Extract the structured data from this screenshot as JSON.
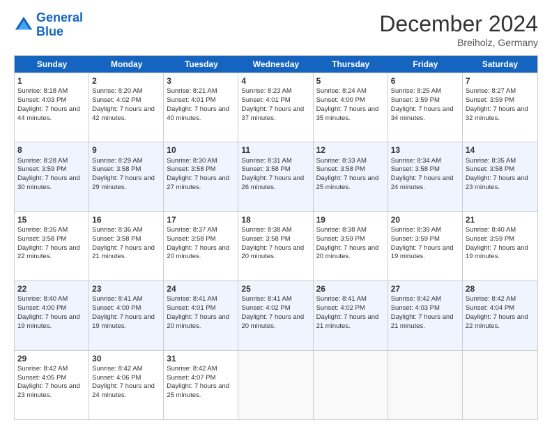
{
  "header": {
    "logo_line1": "General",
    "logo_line2": "Blue",
    "title": "December 2024",
    "subtitle": "Breiholz, Germany"
  },
  "days": [
    "Sunday",
    "Monday",
    "Tuesday",
    "Wednesday",
    "Thursday",
    "Friday",
    "Saturday"
  ],
  "rows": [
    [
      {
        "num": "1",
        "rise": "8:18 AM",
        "set": "4:03 PM",
        "daylight": "7 hours and 44 minutes."
      },
      {
        "num": "2",
        "rise": "8:20 AM",
        "set": "4:02 PM",
        "daylight": "7 hours and 42 minutes."
      },
      {
        "num": "3",
        "rise": "8:21 AM",
        "set": "4:01 PM",
        "daylight": "7 hours and 40 minutes."
      },
      {
        "num": "4",
        "rise": "8:23 AM",
        "set": "4:01 PM",
        "daylight": "7 hours and 37 minutes."
      },
      {
        "num": "5",
        "rise": "8:24 AM",
        "set": "4:00 PM",
        "daylight": "7 hours and 35 minutes."
      },
      {
        "num": "6",
        "rise": "8:25 AM",
        "set": "3:59 PM",
        "daylight": "7 hours and 34 minutes."
      },
      {
        "num": "7",
        "rise": "8:27 AM",
        "set": "3:59 PM",
        "daylight": "7 hours and 32 minutes."
      }
    ],
    [
      {
        "num": "8",
        "rise": "8:28 AM",
        "set": "3:59 PM",
        "daylight": "7 hours and 30 minutes."
      },
      {
        "num": "9",
        "rise": "8:29 AM",
        "set": "3:58 PM",
        "daylight": "7 hours and 29 minutes."
      },
      {
        "num": "10",
        "rise": "8:30 AM",
        "set": "3:58 PM",
        "daylight": "7 hours and 27 minutes."
      },
      {
        "num": "11",
        "rise": "8:31 AM",
        "set": "3:58 PM",
        "daylight": "7 hours and 26 minutes."
      },
      {
        "num": "12",
        "rise": "8:33 AM",
        "set": "3:58 PM",
        "daylight": "7 hours and 25 minutes."
      },
      {
        "num": "13",
        "rise": "8:34 AM",
        "set": "3:58 PM",
        "daylight": "7 hours and 24 minutes."
      },
      {
        "num": "14",
        "rise": "8:35 AM",
        "set": "3:58 PM",
        "daylight": "7 hours and 23 minutes."
      }
    ],
    [
      {
        "num": "15",
        "rise": "8:35 AM",
        "set": "3:58 PM",
        "daylight": "7 hours and 22 minutes."
      },
      {
        "num": "16",
        "rise": "8:36 AM",
        "set": "3:58 PM",
        "daylight": "7 hours and 21 minutes."
      },
      {
        "num": "17",
        "rise": "8:37 AM",
        "set": "3:58 PM",
        "daylight": "7 hours and 20 minutes."
      },
      {
        "num": "18",
        "rise": "8:38 AM",
        "set": "3:58 PM",
        "daylight": "7 hours and 20 minutes."
      },
      {
        "num": "19",
        "rise": "8:38 AM",
        "set": "3:59 PM",
        "daylight": "7 hours and 20 minutes."
      },
      {
        "num": "20",
        "rise": "8:39 AM",
        "set": "3:59 PM",
        "daylight": "7 hours and 19 minutes."
      },
      {
        "num": "21",
        "rise": "8:40 AM",
        "set": "3:59 PM",
        "daylight": "7 hours and 19 minutes."
      }
    ],
    [
      {
        "num": "22",
        "rise": "8:40 AM",
        "set": "4:00 PM",
        "daylight": "7 hours and 19 minutes."
      },
      {
        "num": "23",
        "rise": "8:41 AM",
        "set": "4:00 PM",
        "daylight": "7 hours and 19 minutes."
      },
      {
        "num": "24",
        "rise": "8:41 AM",
        "set": "4:01 PM",
        "daylight": "7 hours and 20 minutes."
      },
      {
        "num": "25",
        "rise": "8:41 AM",
        "set": "4:02 PM",
        "daylight": "7 hours and 20 minutes."
      },
      {
        "num": "26",
        "rise": "8:41 AM",
        "set": "4:02 PM",
        "daylight": "7 hours and 21 minutes."
      },
      {
        "num": "27",
        "rise": "8:42 AM",
        "set": "4:03 PM",
        "daylight": "7 hours and 21 minutes."
      },
      {
        "num": "28",
        "rise": "8:42 AM",
        "set": "4:04 PM",
        "daylight": "7 hours and 22 minutes."
      }
    ],
    [
      {
        "num": "29",
        "rise": "8:42 AM",
        "set": "4:05 PM",
        "daylight": "7 hours and 23 minutes."
      },
      {
        "num": "30",
        "rise": "8:42 AM",
        "set": "4:06 PM",
        "daylight": "7 hours and 24 minutes."
      },
      {
        "num": "31",
        "rise": "8:42 AM",
        "set": "4:07 PM",
        "daylight": "7 hours and 25 minutes."
      },
      null,
      null,
      null,
      null
    ]
  ]
}
